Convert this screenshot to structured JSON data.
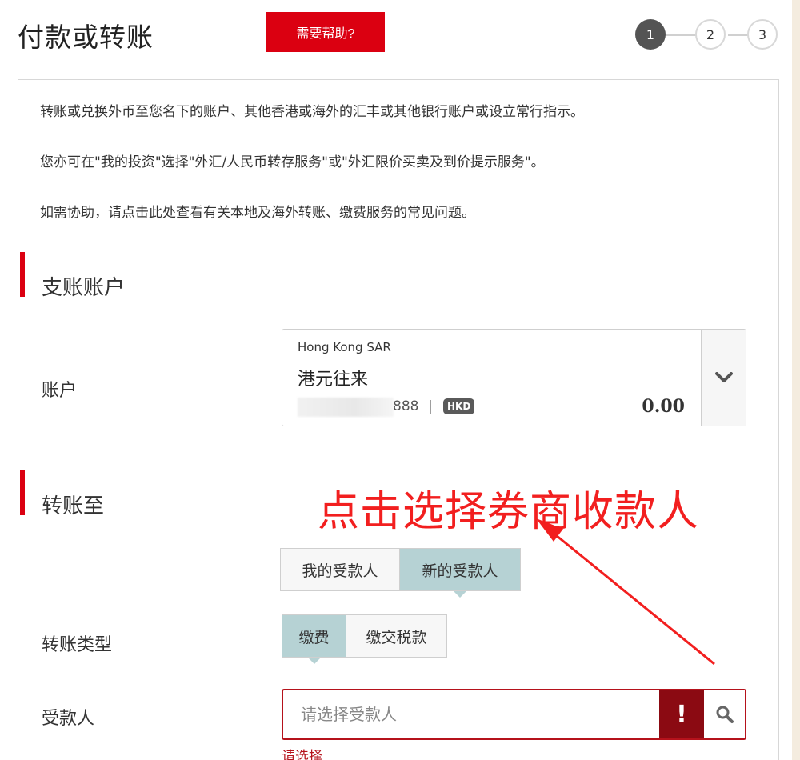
{
  "header": {
    "title": "付款或转账",
    "help_label": "需要帮助?",
    "steps": [
      "1",
      "2",
      "3"
    ],
    "active_step": 1
  },
  "intro": {
    "line1": "转账或兑换外币至您名下的账户、其他香港或海外的汇丰或其他银行账户或设立常行指示。",
    "line2": "您亦可在\"我的投资\"选择\"外汇/人民币转存服务\"或\"外汇限价买卖及到价提示服务\"。",
    "line3_before": "如需协助，请点击",
    "line3_link": "此处",
    "line3_after": "查看有关本地及海外转账、缴费服务的常见问题。"
  },
  "debit_section": {
    "title": "支账账户",
    "account_label": "账户",
    "account": {
      "region": "Hong Kong SAR",
      "name": "港元往来",
      "number_suffix": "888",
      "separator": "|",
      "currency": "HKD",
      "balance": "0.00"
    }
  },
  "transfer_section": {
    "title": "转账至",
    "payee_tabs": [
      "我的受款人",
      "新的受款人"
    ],
    "payee_tab_selected": "新的受款人",
    "type_label": "转账类型",
    "type_tabs": [
      "缴费",
      "缴交税款"
    ],
    "type_tab_selected": "缴费",
    "payee_label": "受款人",
    "payee_placeholder": "请选择受款人",
    "payee_error": "请选择"
  },
  "annotation": {
    "text": "点击选择券商收款人"
  },
  "colors": {
    "brand_red": "#db0011",
    "error_red": "#b5121b",
    "error_icon_bg": "#8b0a12",
    "selected_tab": "#b6d2d4",
    "annotation_red": "#f21f1f"
  },
  "icons": {
    "dropdown": "chevron-down-icon",
    "search": "search-icon",
    "error": "exclamation-icon"
  }
}
